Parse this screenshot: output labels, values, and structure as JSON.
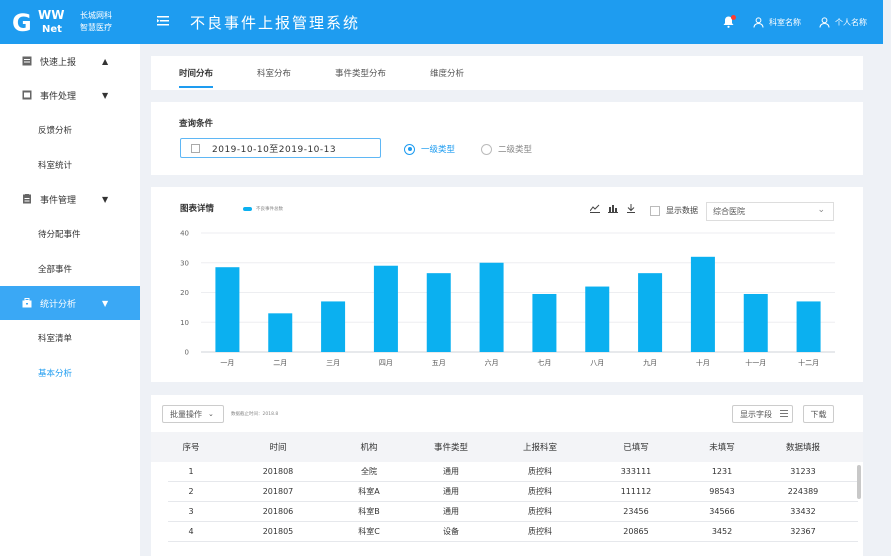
{
  "header": {
    "logo_letters": "G",
    "logo_ww": "WW",
    "logo_net": "Net",
    "company_line1": "长城网科",
    "company_line2": "智慧医疗",
    "title": "不良事件上报管理系统",
    "dept_name": "科室名称",
    "personal_name": "个人名称",
    "colors": {
      "primary": "#1e9cf0",
      "active_side": "#3aa8f5",
      "bar": "#0bb0f0"
    }
  },
  "sidebar": {
    "items": [
      {
        "label": "快速上报",
        "caret": "▲"
      },
      {
        "label": "事件处理",
        "caret": "▼"
      },
      {
        "label": "反馈分析"
      },
      {
        "label": "科室统计"
      },
      {
        "label": "事件管理",
        "caret": "▼"
      },
      {
        "label": "待分配事件"
      },
      {
        "label": "全部事件"
      },
      {
        "label": "统计分析",
        "caret": "▼"
      },
      {
        "label": "科室清单"
      },
      {
        "label": "基本分析"
      }
    ]
  },
  "tabs": [
    "时间分布",
    "科室分布",
    "事件类型分布",
    "维度分析"
  ],
  "query": {
    "title": "查询条件",
    "date_range": "2019-10-10至2019-10-13",
    "radio1": "一级类型",
    "radio2": "二级类型"
  },
  "chart_panel": {
    "title": "图表详情",
    "legend": "不良事件总数",
    "show_data": "显示数据",
    "select_value": "综合医院"
  },
  "chart_data": {
    "type": "bar",
    "title": "",
    "categories": [
      "一月",
      "二月",
      "三月",
      "四月",
      "五月",
      "六月",
      "七月",
      "八月",
      "九月",
      "十月",
      "十一月",
      "十二月"
    ],
    "series": [
      {
        "name": "不良事件总数",
        "values": [
          28.5,
          13,
          17,
          29,
          26.5,
          30,
          19.5,
          22,
          26.5,
          32,
          19.5,
          17
        ]
      }
    ],
    "ylim": [
      0,
      40
    ],
    "yticks": [
      "0",
      "10",
      "20",
      "30",
      "40"
    ],
    "grid": true,
    "legend_position": "top-left"
  },
  "table": {
    "batch_label": "批量操作",
    "updated_text": "数据截止时间：2018.8",
    "show_fields_label": "显示字段",
    "download_label": "下载",
    "headers": [
      "序号",
      "时间",
      "机构",
      "事件类型",
      "上报科室",
      "已填写",
      "未填写",
      "数据填报"
    ],
    "rows": [
      [
        "1",
        "201808",
        "全院",
        "通用",
        "质控科",
        "333111",
        "1231",
        "31233"
      ],
      [
        "2",
        "201807",
        "科室A",
        "通用",
        "质控科",
        "111112",
        "98543",
        "224389"
      ],
      [
        "3",
        "201806",
        "科室B",
        "通用",
        "质控科",
        "23456",
        "34566",
        "33432"
      ],
      [
        "4",
        "201805",
        "科室C",
        "设备",
        "质控科",
        "20865",
        "3452",
        "32367"
      ]
    ]
  }
}
